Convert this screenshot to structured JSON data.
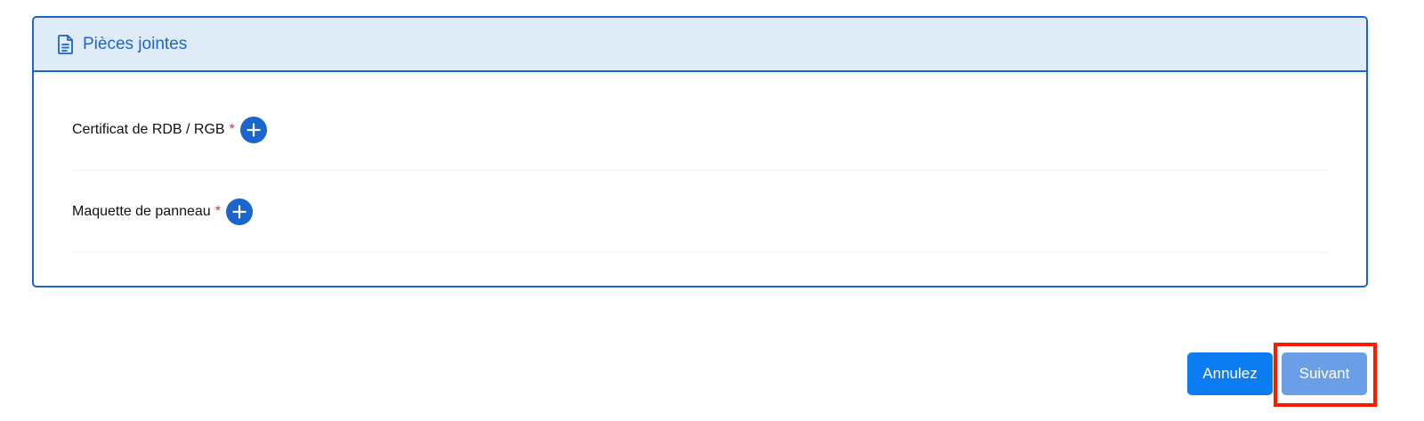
{
  "panel": {
    "title": "Pièces jointes",
    "icon": "document-icon",
    "accent_color": "#1a66cc",
    "header_bg": "#e0ebf8"
  },
  "attachments": [
    {
      "label": "Certificat de RDB / RGB",
      "required_marker": "*",
      "add_icon": "plus-circle-icon"
    },
    {
      "label": "Maquette de panneau",
      "required_marker": "*",
      "add_icon": "plus-circle-icon"
    }
  ],
  "actions": {
    "cancel_label": "Annulez",
    "next_label": "Suivant",
    "cancel_color": "#0b7cf2",
    "next_color": "#6a9ee6",
    "highlight_color": "#ff1a00"
  }
}
